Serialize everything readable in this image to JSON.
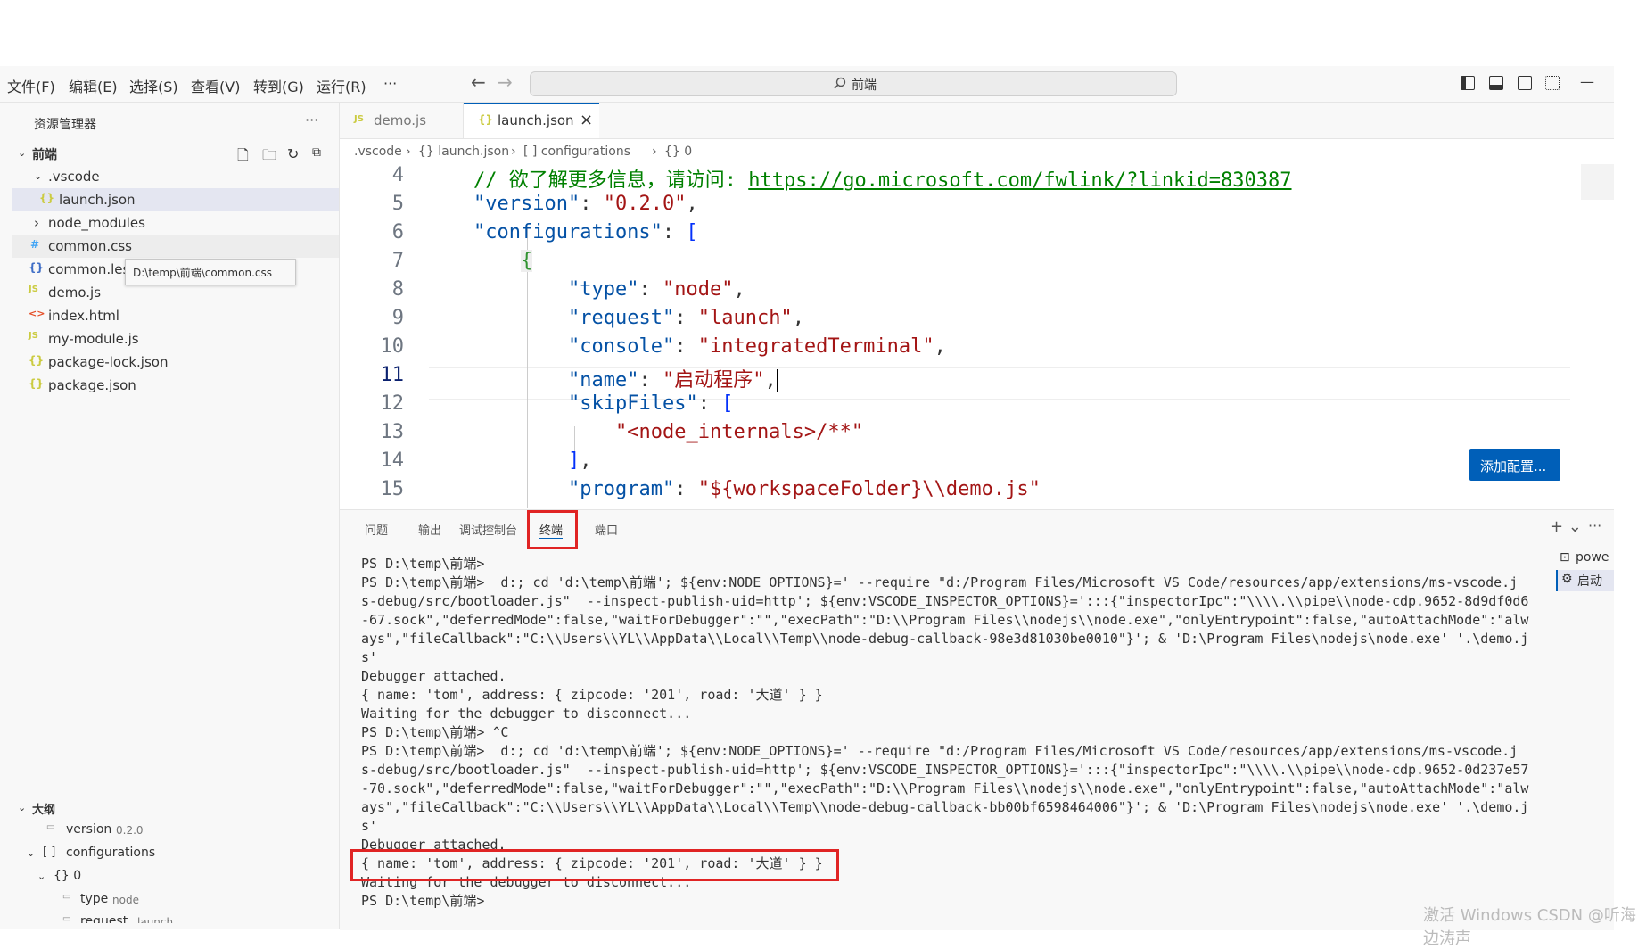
{
  "menubar": {
    "items": [
      "文件(F)",
      "编辑(E)",
      "选择(S)",
      "查看(V)",
      "转到(G)",
      "运行(R)",
      "···"
    ],
    "search_text": "前端",
    "minimize": "—"
  },
  "sidebar": {
    "title": "资源管理器",
    "more": "···",
    "folder": "前端",
    "files": [
      {
        "label": ".vscode",
        "icon": "›"
      },
      {
        "label": "launch.json",
        "icon": "{}"
      },
      {
        "label": "node_modules",
        "icon": "›"
      },
      {
        "label": "common.css",
        "icon": "#"
      },
      {
        "label": "common.les",
        "icon": "{}"
      },
      {
        "label": "demo.js",
        "icon": "JS"
      },
      {
        "label": "index.html",
        "icon": "<>"
      },
      {
        "label": "my-module.js",
        "icon": "JS"
      },
      {
        "label": "package-lock.json",
        "icon": "{}"
      },
      {
        "label": "package.json",
        "icon": "{}"
      }
    ],
    "tooltip": "D:\\temp\\前端\\common.css",
    "outline_title": "大纲",
    "outline": [
      {
        "label": "version",
        "value": "0.2.0"
      },
      {
        "label": "configurations",
        "value": ""
      },
      {
        "label": "{} 0",
        "value": ""
      },
      {
        "label": "type",
        "value": "node"
      },
      {
        "label": "request",
        "value": "launch"
      }
    ]
  },
  "tabs": [
    {
      "icon": "JS",
      "label": "demo.js"
    },
    {
      "icon": "{}",
      "label": "launch.json",
      "close": "×"
    }
  ],
  "breadcrumb": [
    ".vscode",
    "{} launch.json",
    "[ ] configurations",
    "{} 0"
  ],
  "editor": {
    "line_numbers": [
      "4",
      "5",
      "6",
      "7",
      "8",
      "9",
      "10",
      "11",
      "12",
      "13",
      "14",
      "15"
    ],
    "comment": "// 欲了解更多信息，请访问: ",
    "link": "https://go.microsoft.com/fwlink/?linkid=830387",
    "lines": {
      "version_key": "\"version\"",
      "version_val": "\"0.2.0\"",
      "config_key": "\"configurations\"",
      "type_key": "\"type\"",
      "type_val": "\"node\"",
      "request_key": "\"request\"",
      "request_val": "\"launch\"",
      "console_key": "\"console\"",
      "console_val": "\"integratedTerminal\"",
      "name_key": "\"name\"",
      "name_val": "\"启动程序\"",
      "skip_key": "\"skipFiles\"",
      "skip_val": "\"<node_internals>/**\"",
      "program_key": "\"program\"",
      "program_val": "\"${workspaceFolder}\\\\demo.js\""
    },
    "add_config": "添加配置..."
  },
  "panel": {
    "tabs": [
      "问题",
      "输出",
      "调试控制台",
      "终端",
      "端口"
    ],
    "actions": [
      "+ ⌄",
      "···"
    ],
    "side_terminals": [
      "powe",
      "启动"
    ],
    "terminal_lines": [
      "PS D:\\temp\\前端>",
      "PS D:\\temp\\前端>  d:; cd 'd:\\temp\\前端'; ${env:NODE_OPTIONS}=' --require \"d:/Program Files/Microsoft VS Code/resources/app/extensions/ms-vscode.j",
      "s-debug/src/bootloader.js\"  --inspect-publish-uid=http'; ${env:VSCODE_INSPECTOR_OPTIONS}=':::{\"inspectorIpc\":\"\\\\\\\\.\\\\pipe\\\\node-cdp.9652-8d9df0d6",
      "-67.sock\",\"deferredMode\":false,\"waitForDebugger\":\"\",\"execPath\":\"D:\\\\Program Files\\\\nodejs\\\\node.exe\",\"onlyEntrypoint\":false,\"autoAttachMode\":\"alw",
      "ays\",\"fileCallback\":\"C:\\\\Users\\\\YL\\\\AppData\\\\Local\\\\Temp\\\\node-debug-callback-98e3d81030be0010\"}'; & 'D:\\Program Files\\nodejs\\node.exe' '.\\demo.j",
      "s'",
      "Debugger attached.",
      "{ name: 'tom', address: { zipcode: '201', road: '大道' } }",
      "Waiting for the debugger to disconnect...",
      "PS D:\\temp\\前端> ^C",
      "PS D:\\temp\\前端>  d:; cd 'd:\\temp\\前端'; ${env:NODE_OPTIONS}=' --require \"d:/Program Files/Microsoft VS Code/resources/app/extensions/ms-vscode.j",
      "s-debug/src/bootloader.js\"  --inspect-publish-uid=http'; ${env:VSCODE_INSPECTOR_OPTIONS}=':::{\"inspectorIpc\":\"\\\\\\\\.\\\\pipe\\\\node-cdp.9652-0d237e57",
      "-70.sock\",\"deferredMode\":false,\"waitForDebugger\":\"\",\"execPath\":\"D:\\\\Program Files\\\\nodejs\\\\node.exe\",\"onlyEntrypoint\":false,\"autoAttachMode\":\"alw",
      "ays\",\"fileCallback\":\"C:\\\\Users\\\\YL\\\\AppData\\\\Local\\\\Temp\\\\node-debug-callback-bb00bf6598464006\"}'; & 'D:\\Program Files\\nodejs\\node.exe' '.\\demo.j",
      "s'",
      "Debugger attached.",
      "{ name: 'tom', address: { zipcode: '201', road: '大道' } }",
      "Waiting for the debugger to disconnect...",
      "PS D:\\temp\\前端> "
    ]
  },
  "watermark": "激活 Windows CSDN @听海边涛声"
}
